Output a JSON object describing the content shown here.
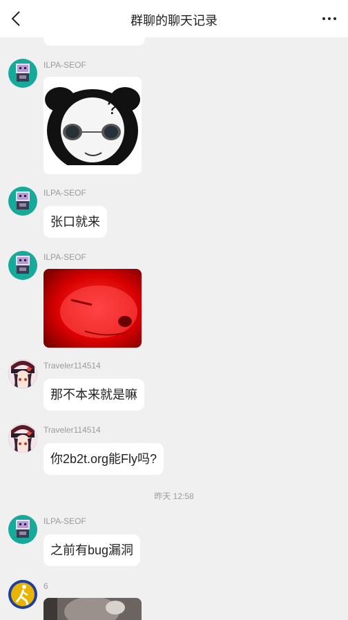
{
  "header": {
    "title": "群聊的聊天记录",
    "back_icon": "chevron-left-icon",
    "more_icon": "more-dots-icon"
  },
  "messages": [
    {
      "sender": "ILPA-SEOF",
      "type": "image",
      "image": "panda-meme-sticker"
    },
    {
      "sender": "ILPA-SEOF",
      "type": "text",
      "text": "张口就来"
    },
    {
      "sender": "ILPA-SEOF",
      "type": "image",
      "image": "red-dog-meme"
    },
    {
      "sender": "Traveler114514",
      "type": "text",
      "text": "那不本来就是嘛"
    },
    {
      "sender": "Traveler114514",
      "type": "text",
      "text": "你2b2t.org能Fly吗?"
    },
    {
      "type": "timestamp",
      "text": "昨天 12:58"
    },
    {
      "sender": "ILPA-SEOF",
      "type": "text",
      "text": "之前有bug漏洞"
    },
    {
      "sender": "6",
      "type": "image",
      "image": "photo"
    }
  ],
  "colors": {
    "background": "#f0f0f0",
    "bubble": "#ffffff",
    "name_text": "#9a9a9a",
    "ilpa_avatar_bg": "#17a99a",
    "traveler_avatar_bg": "#3a2a4a",
    "six_avatar_bg": "#1f3f9f"
  }
}
